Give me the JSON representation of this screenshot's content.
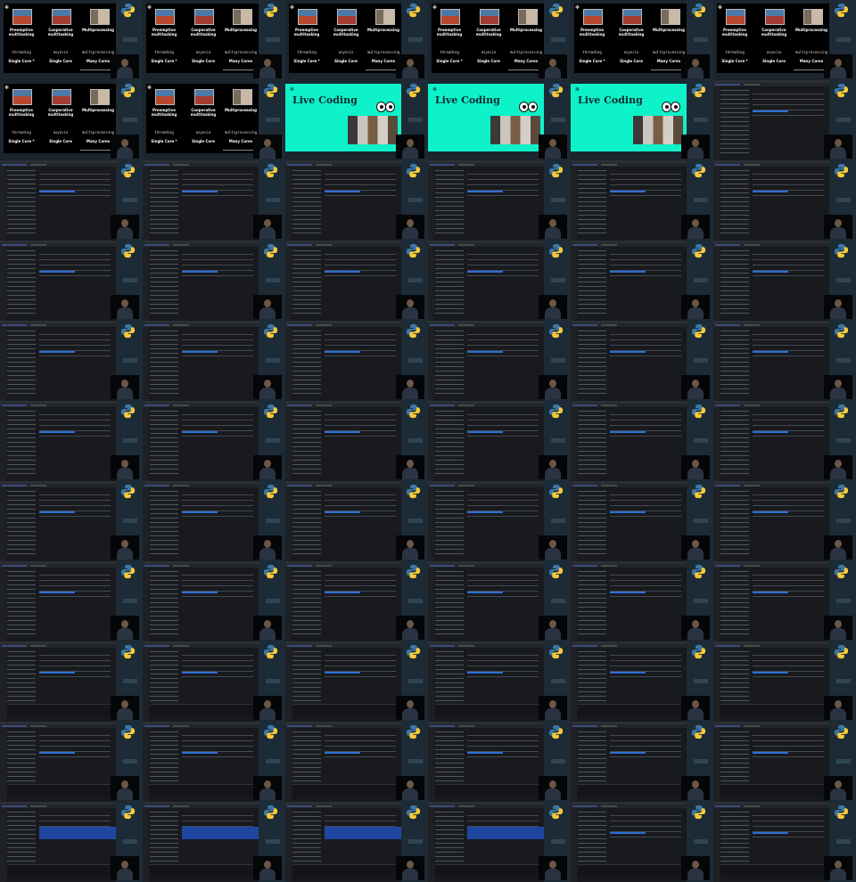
{
  "contact_sheet": {
    "columns": 6,
    "rows": 11
  },
  "slide": {
    "star": "✻",
    "columns": [
      {
        "heading": "Preemptive multitasking",
        "library": "threading",
        "cores": "Single Core *"
      },
      {
        "heading": "Cooperative multitasking",
        "library": "asyncio",
        "cores": "Single Core"
      },
      {
        "heading": "Multiprocessing",
        "library": "multiprocessing",
        "cores": "Many Cores"
      }
    ]
  },
  "live_slide": {
    "star": "✻",
    "title": "Live Coding"
  },
  "sidebar": {
    "logo": "python-logo-icon",
    "accent_color": "#3f8fd2"
  },
  "frames": [
    "slide",
    "slide",
    "slide",
    "slide",
    "slide",
    "slide",
    "slide",
    "slide",
    "live",
    "live",
    "live",
    "editor",
    "editor",
    "editor",
    "editor",
    "editor",
    "editor",
    "editor",
    "editor",
    "editor",
    "editor",
    "editor",
    "editor",
    "editor",
    "editor",
    "editor",
    "editor",
    "editor",
    "editor",
    "editor",
    "editor",
    "editor",
    "editor",
    "editor",
    "editor",
    "editor",
    "editor",
    "editor",
    "editor",
    "editor",
    "editor",
    "editor",
    "editor",
    "editor",
    "editor",
    "editor",
    "editor",
    "editor",
    "editor-term",
    "editor-term",
    "editor-term",
    "editor-term",
    "editor-term",
    "editor-term",
    "editor-term",
    "editor-term",
    "editor-term",
    "editor-term",
    "editor-term",
    "editor-term",
    "editor-select",
    "editor-select",
    "editor-select",
    "editor-select",
    "editor-term",
    "editor-term"
  ]
}
